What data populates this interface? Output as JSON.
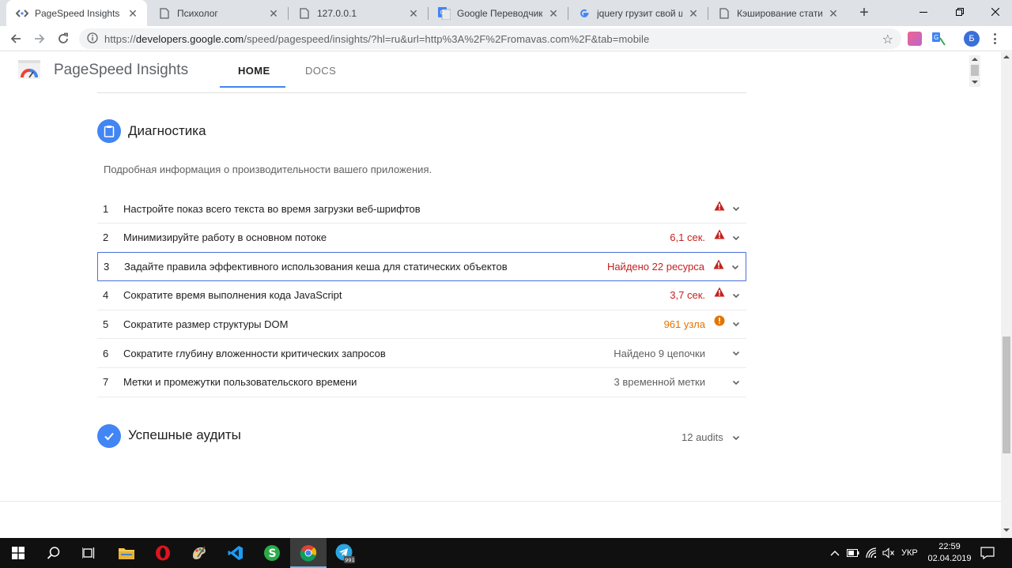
{
  "browser": {
    "tabs": [
      {
        "title": "PageSpeed Insights",
        "icon": "pagespeed-favicon",
        "active": true
      },
      {
        "title": "Психолог",
        "icon": "document-icon",
        "active": false
      },
      {
        "title": "127.0.0.1",
        "icon": "document-icon",
        "active": false
      },
      {
        "title": "Google Переводчик",
        "icon": "google-translate-icon",
        "active": false
      },
      {
        "title": "jquery грузит свой шри",
        "icon": "google-g-icon",
        "active": false
      },
      {
        "title": "Кэширование статики",
        "icon": "document-icon",
        "active": false
      }
    ],
    "address": {
      "scheme": "https://",
      "host": "developers.google.com",
      "path": "/speed/pagespeed/insights/?hl=ru&url=http%3A%2F%2Fromavas.com%2F&tab=mobile"
    },
    "profile_initial": "Б"
  },
  "header": {
    "brand": "PageSpeed Insights",
    "nav": {
      "home": "HOME",
      "docs": "DOCS"
    }
  },
  "diagnostics": {
    "title": "Диагностика",
    "description": "Подробная информация о производительности вашего приложения.",
    "audits": [
      {
        "num": "1",
        "title": "Настройте показ всего текста во время загрузки веб-шрифтов",
        "value": "",
        "status": "fail"
      },
      {
        "num": "2",
        "title": "Минимизируйте работу в основном потоке",
        "value": "6,1 сек.",
        "status": "fail"
      },
      {
        "num": "3",
        "title": "Задайте правила эффективного использования кеша для статических объектов",
        "value": "Найдено 22 ресурса",
        "status": "fail"
      },
      {
        "num": "4",
        "title": "Сократите время выполнения кода JavaScript",
        "value": "3,7 сек.",
        "status": "fail"
      },
      {
        "num": "5",
        "title": "Сократите размер структуры DOM",
        "value": "961 узла",
        "status": "average"
      },
      {
        "num": "6",
        "title": "Сократите глубину вложенности критических запросов",
        "value": "Найдено 9 цепочки",
        "status": "info"
      },
      {
        "num": "7",
        "title": "Метки и промежутки пользовательского времени",
        "value": "3 временной метки",
        "status": "info"
      }
    ]
  },
  "passed": {
    "title": "Успешные аудиты",
    "count": "12 audits"
  },
  "taskbar": {
    "apps": [
      "windows-start-icon",
      "search-icon",
      "task-view-icon",
      "file-explorer-icon",
      "opera-icon",
      "paint-icon",
      "vscode-icon",
      "skype-icon",
      "chrome-icon",
      "telegram-icon"
    ],
    "telegram_badge": "991",
    "language": "УКР",
    "time": "22:59",
    "date": "02.04.2019"
  },
  "colors": {
    "accent": "#4285f4",
    "fail": "#c5221f",
    "average": "#e37400"
  }
}
